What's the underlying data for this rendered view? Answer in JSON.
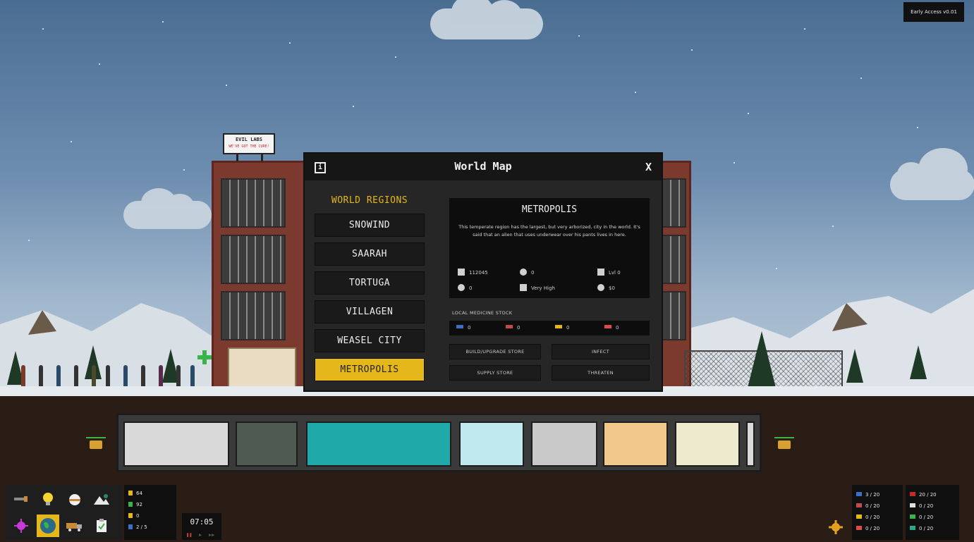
{
  "version": "Early Access v0.01",
  "billboard": {
    "name": "EVIL LABS",
    "tagline": "WE'VE GOT THE CURE!"
  },
  "dialog": {
    "title": "World Map",
    "info_icon": "info-icon",
    "close_label": "X",
    "regions_title": "WORLD REGIONS",
    "regions": [
      "SNOWIND",
      "SAARAH",
      "TORTUGA",
      "VILLAGEN",
      "WEASEL CITY",
      "METROPOLIS"
    ],
    "selected_region": "METROPOLIS",
    "region_info": {
      "name": "METROPOLIS",
      "description": "This temperate region has the largest, but very arborized, city in the world. It's said that an alien that uses underwear over his pants lives in here.",
      "population": "112045",
      "deaths": "0",
      "store_level": "Lvl 0",
      "infected": "0",
      "wealth": "Very High",
      "money": "$0"
    },
    "stock_label": "LOCAL MEDICINE STOCK",
    "stock": [
      {
        "icon": "pill-blue-icon",
        "value": "0",
        "color": "#3a6fc4"
      },
      {
        "icon": "flask-icon",
        "value": "0",
        "color": "#c44a4a"
      },
      {
        "icon": "capsule-icon",
        "value": "0",
        "color": "#e5b71a"
      },
      {
        "icon": "syringe-icon",
        "value": "0",
        "color": "#e04a4a"
      }
    ],
    "actions": {
      "build_store": "BUILD/UPGRADE STORE",
      "infect": "INFECT",
      "supply_store": "SUPPLY STORE",
      "threaten": "THREATEN"
    }
  },
  "resources": [
    {
      "icon": "coins-icon",
      "value": "64",
      "color": "#e5b71a"
    },
    {
      "icon": "flask-icon",
      "value": "92",
      "color": "#3bb24a"
    },
    {
      "icon": "energy-icon",
      "value": "0",
      "color": "#e5b71a"
    },
    {
      "icon": "staff-icon",
      "value": "2 / 5",
      "color": "#3a6fc4"
    }
  ],
  "clock": {
    "time": "07:05"
  },
  "capacity_left": [
    {
      "icon": "pill-blue-icon",
      "value": "3 / 20",
      "color": "#3a6fc4"
    },
    {
      "icon": "flask-icon",
      "value": "0 / 20",
      "color": "#c44a4a"
    },
    {
      "icon": "capsule-icon",
      "value": "0 / 20",
      "color": "#e5b71a"
    },
    {
      "icon": "syringe-icon",
      "value": "0 / 20",
      "color": "#e04a4a"
    }
  ],
  "capacity_right": [
    {
      "icon": "virus-icon",
      "value": "20 / 20",
      "color": "#c42a2a"
    },
    {
      "icon": "cloud-icon",
      "value": "0 / 20",
      "color": "#e0e0e0"
    },
    {
      "icon": "drop-icon",
      "value": "0 / 20",
      "color": "#3bb24a"
    },
    {
      "icon": "orb-icon",
      "value": "0 / 20",
      "color": "#2aa88a"
    }
  ],
  "accent_color": "#e5b71a"
}
